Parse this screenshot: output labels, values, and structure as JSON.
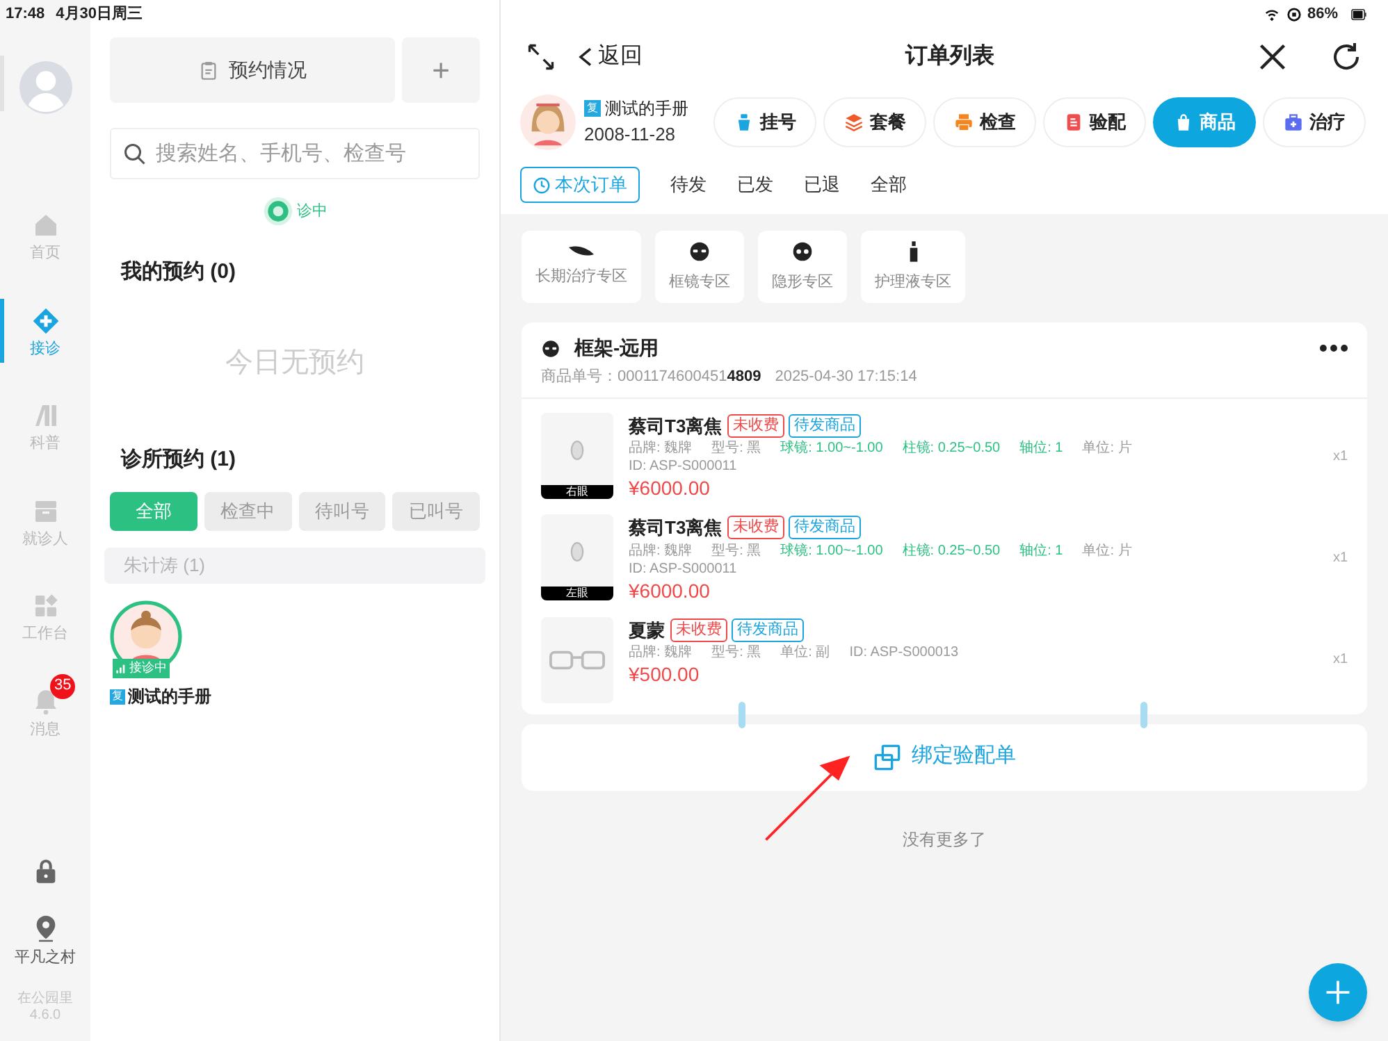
{
  "status_bar": {
    "time": "17:48",
    "date": "4月30日周三",
    "battery": "86%"
  },
  "sidebar": {
    "items": [
      {
        "label": "首页",
        "kind": "home",
        "selected": false
      },
      {
        "label": "接诊",
        "kind": "clinic",
        "selected": true
      },
      {
        "label": "科普",
        "kind": "books",
        "selected": false
      },
      {
        "label": "就诊人",
        "kind": "box",
        "selected": false
      },
      {
        "label": "工作台",
        "kind": "grid",
        "selected": false
      },
      {
        "label": "消息",
        "kind": "bell",
        "selected": false,
        "badge": "35"
      }
    ],
    "location": "平凡之村",
    "app_name": "在公园里",
    "version": "4.6.0"
  },
  "middle": {
    "appointments_button": "预约情况",
    "add_button": "+",
    "search": {
      "placeholder": "搜索姓名、手机号、检查号"
    },
    "status": "诊中",
    "my_appointments": {
      "title": "我的预约 (0)",
      "empty": "今日无预约"
    },
    "clinic_appointments": {
      "title": "诊所预约 (1)",
      "filters": [
        {
          "label": "全部",
          "selected": true
        },
        {
          "label": "检查中",
          "selected": false
        },
        {
          "label": "待叫号",
          "selected": false
        },
        {
          "label": "已叫号",
          "selected": false
        }
      ],
      "group": "朱计涛 (1)",
      "patients": [
        {
          "status": "接诊中",
          "tag": "复",
          "name": "测试的手册"
        }
      ]
    }
  },
  "order_panel": {
    "back": "返回",
    "title": "订单列表",
    "patient": {
      "tag": "复",
      "name": "测试的手册",
      "birthdate": "2008-11-28"
    },
    "categories": [
      {
        "label": "挂号",
        "kind": "register",
        "selected": false
      },
      {
        "label": "套餐",
        "kind": "package",
        "selected": false
      },
      {
        "label": "检查",
        "kind": "exam",
        "selected": false
      },
      {
        "label": "验配",
        "kind": "fitting",
        "selected": false
      },
      {
        "label": "商品",
        "kind": "goods",
        "selected": true
      },
      {
        "label": "治疗",
        "kind": "treatment",
        "selected": false
      }
    ],
    "tabs": [
      {
        "label": "本次订单",
        "selected": true
      },
      {
        "label": "待发",
        "selected": false
      },
      {
        "label": "已发",
        "selected": false
      },
      {
        "label": "已退",
        "selected": false
      },
      {
        "label": "全部",
        "selected": false
      }
    ],
    "zones": [
      {
        "label": "长期治疗专区",
        "kind": "lens"
      },
      {
        "label": "框镜专区",
        "kind": "frame"
      },
      {
        "label": "隐形专区",
        "kind": "contact"
      },
      {
        "label": "护理液专区",
        "kind": "bottle"
      }
    ],
    "order": {
      "title": "框架-远用",
      "number_label": "商品单号：",
      "number": "0001174600451**4809**",
      "datetime": "2025-04-30 17:15:14",
      "items": [
        {
          "kind": "lens",
          "eye": "右眼",
          "name": "蔡司T3离焦",
          "tags": [
            {
              "label": "未收费",
              "kind": "unpaid"
            },
            {
              "label": "待发商品",
              "kind": "pending"
            }
          ],
          "lines": [
            [
              {
                "text": "品牌: 魏牌",
                "highlight": false
              },
              {
                "text": "型号: 黑",
                "highlight": false
              },
              {
                "text": "球镜: 1.00~-1.00",
                "highlight": true
              },
              {
                "text": "柱镜: 0.25~0.50",
                "highlight": true
              },
              {
                "text": "轴位: 1",
                "highlight": true
              },
              {
                "text": "单位: 片",
                "highlight": false
              }
            ],
            [
              {
                "text": "ID: ASP-S000011",
                "highlight": false
              }
            ]
          ],
          "price": "¥6000.00",
          "qty": "x1"
        },
        {
          "kind": "lens",
          "eye": "左眼",
          "name": "蔡司T3离焦",
          "tags": [
            {
              "label": "未收费",
              "kind": "unpaid"
            },
            {
              "label": "待发商品",
              "kind": "pending"
            }
          ],
          "lines": [
            [
              {
                "text": "品牌: 魏牌",
                "highlight": false
              },
              {
                "text": "型号: 黑",
                "highlight": false
              },
              {
                "text": "球镜: 1.00~-1.00",
                "highlight": true
              },
              {
                "text": "柱镜: 0.25~0.50",
                "highlight": true
              },
              {
                "text": "轴位: 1",
                "highlight": true
              },
              {
                "text": "单位: 片",
                "highlight": false
              }
            ],
            [
              {
                "text": "ID: ASP-S000011",
                "highlight": false
              }
            ]
          ],
          "price": "¥6000.00",
          "qty": "x1"
        },
        {
          "kind": "glasses",
          "name": "夏蒙",
          "tags": [
            {
              "label": "未收费",
              "kind": "unpaid"
            },
            {
              "label": "待发商品",
              "kind": "pending"
            }
          ],
          "lines": [
            [
              {
                "text": "品牌: 魏牌",
                "highlight": false
              },
              {
                "text": "型号: 黑",
                "highlight": false
              },
              {
                "text": "单位: 副",
                "highlight": false
              },
              {
                "text": "ID: ASP-S000013",
                "highlight": false
              }
            ]
          ],
          "price": "¥500.00",
          "qty": "x1"
        }
      ]
    },
    "bind_button": "绑定验配单",
    "footer": "没有更多了"
  }
}
